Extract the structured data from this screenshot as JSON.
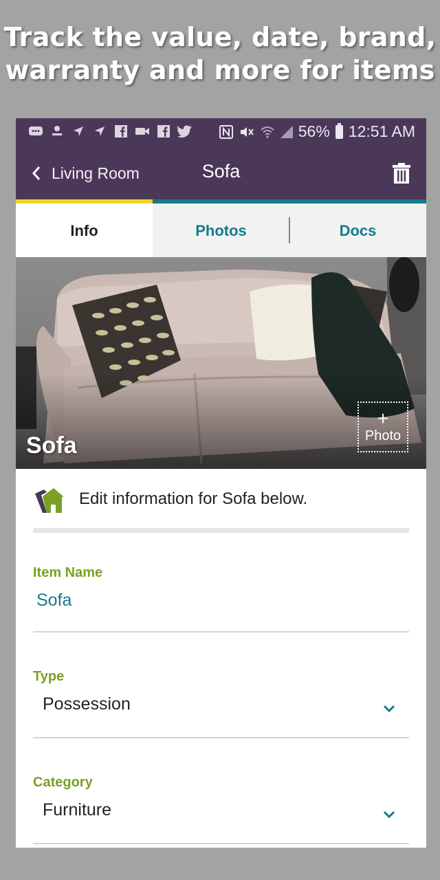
{
  "headline": {
    "line1": "Track the value, date, brand,",
    "line2": "warranty and more for items"
  },
  "statusbar": {
    "battery": "56%",
    "time": "12:51 AM"
  },
  "appbar": {
    "back_label": "Living Room",
    "title": "Sofa"
  },
  "tabs": [
    {
      "label": "Info",
      "active": true
    },
    {
      "label": "Photos",
      "active": false
    },
    {
      "label": "Docs",
      "active": false
    }
  ],
  "hero": {
    "title": "Sofa",
    "add_photo_icon": "+",
    "add_photo_label": "Photo"
  },
  "notice": {
    "text": "Edit information for Sofa below."
  },
  "form": {
    "item_name_label": "Item Name",
    "item_name_value": "Sofa",
    "type_label": "Type",
    "type_value": "Possession",
    "category_label": "Category",
    "category_value": "Furniture"
  },
  "colors": {
    "appbar": "#4b3859",
    "accent_teal": "#147a8c",
    "accent_yellow": "#f2d12a",
    "label_green": "#7aa024"
  }
}
